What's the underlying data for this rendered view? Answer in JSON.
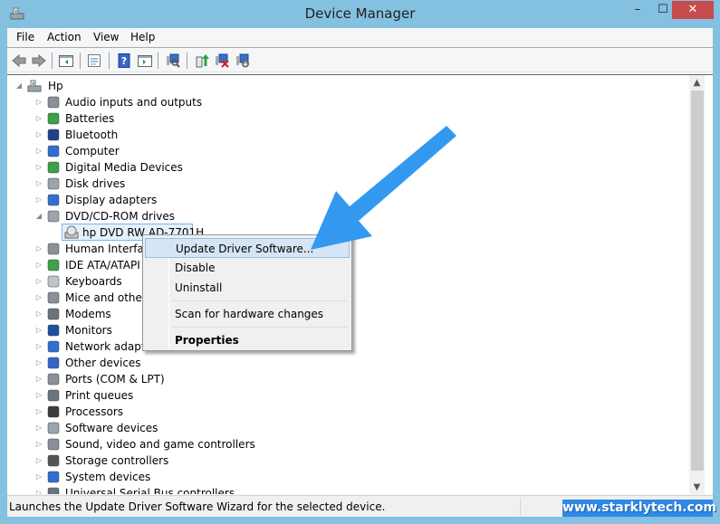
{
  "window": {
    "title": "Device Manager",
    "minimize_glyph": "–",
    "maximize_glyph": "☐",
    "close_glyph": "✕"
  },
  "menubar": {
    "items": [
      {
        "label": "File"
      },
      {
        "label": "Action"
      },
      {
        "label": "View"
      },
      {
        "label": "Help"
      }
    ]
  },
  "toolbar": {
    "buttons": [
      {
        "icon": "back-arrow-icon"
      },
      {
        "icon": "forward-arrow-icon"
      },
      {
        "icon": "show-hide-console-tree-icon"
      },
      {
        "icon": "properties-icon"
      },
      {
        "icon": "help-icon"
      },
      {
        "icon": "show-action-pane-icon"
      },
      {
        "icon": "scan-hardware-icon"
      },
      {
        "icon": "update-driver-icon"
      },
      {
        "icon": "uninstall-device-icon"
      },
      {
        "icon": "disable-device-icon"
      }
    ]
  },
  "tree": {
    "root": {
      "label": "Hp",
      "expanded": true
    },
    "categories": [
      {
        "label": "Audio inputs and outputs",
        "icon": "speaker-icon",
        "expanded": false
      },
      {
        "label": "Batteries",
        "icon": "battery-icon",
        "expanded": false
      },
      {
        "label": "Bluetooth",
        "icon": "bluetooth-icon",
        "expanded": false
      },
      {
        "label": "Computer",
        "icon": "computer-icon",
        "expanded": false
      },
      {
        "label": "Digital Media Devices",
        "icon": "media-device-icon",
        "expanded": false
      },
      {
        "label": "Disk drives",
        "icon": "disk-drive-icon",
        "expanded": false
      },
      {
        "label": "Display adapters",
        "icon": "display-adapter-icon",
        "expanded": false
      },
      {
        "label": "DVD/CD-ROM drives",
        "icon": "dvd-drive-icon",
        "expanded": true,
        "children": [
          {
            "label": "hp DVD RW AD-7701H",
            "selected": true
          }
        ]
      },
      {
        "label": "Human Interface Devices",
        "icon": "hid-icon",
        "expanded": false
      },
      {
        "label": "IDE ATA/ATAPI controllers",
        "icon": "ide-controller-icon",
        "expanded": false
      },
      {
        "label": "Keyboards",
        "icon": "keyboard-icon",
        "expanded": false
      },
      {
        "label": "Mice and other pointing devices",
        "icon": "mouse-icon",
        "expanded": false
      },
      {
        "label": "Modems",
        "icon": "modem-icon",
        "expanded": false
      },
      {
        "label": "Monitors",
        "icon": "monitor-icon",
        "expanded": false
      },
      {
        "label": "Network adapters",
        "icon": "network-adapter-icon",
        "expanded": false
      },
      {
        "label": "Other devices",
        "icon": "unknown-device-icon",
        "expanded": false
      },
      {
        "label": "Ports (COM & LPT)",
        "icon": "port-icon",
        "expanded": false
      },
      {
        "label": "Print queues",
        "icon": "printer-icon",
        "expanded": false
      },
      {
        "label": "Processors",
        "icon": "processor-icon",
        "expanded": false
      },
      {
        "label": "Software devices",
        "icon": "software-device-icon",
        "expanded": false
      },
      {
        "label": "Sound, video and game controllers",
        "icon": "speaker-icon",
        "expanded": false
      },
      {
        "label": "Storage controllers",
        "icon": "storage-controller-icon",
        "expanded": false
      },
      {
        "label": "System devices",
        "icon": "system-device-icon",
        "expanded": false
      },
      {
        "label": "Universal Serial Bus controllers",
        "icon": "usb-icon",
        "expanded": false
      }
    ]
  },
  "context_menu": {
    "items": [
      {
        "label": "Update Driver Software...",
        "highlighted": true
      },
      {
        "label": "Disable"
      },
      {
        "label": "Uninstall"
      },
      {
        "label": "Scan for hardware changes"
      },
      {
        "label": "Properties",
        "bold": true
      }
    ]
  },
  "statusbar": {
    "text": "Launches the Update Driver Software Wizard for the selected device."
  },
  "watermark": {
    "text": "www.starklytech.com"
  },
  "annotation": {
    "arrow_color": "#3399f0"
  },
  "colors": {
    "titlebar": "#84c0df",
    "close_button": "#c74c4d",
    "selection_border": "#7eb4ea",
    "menu_highlight": "#d5e5f5"
  }
}
